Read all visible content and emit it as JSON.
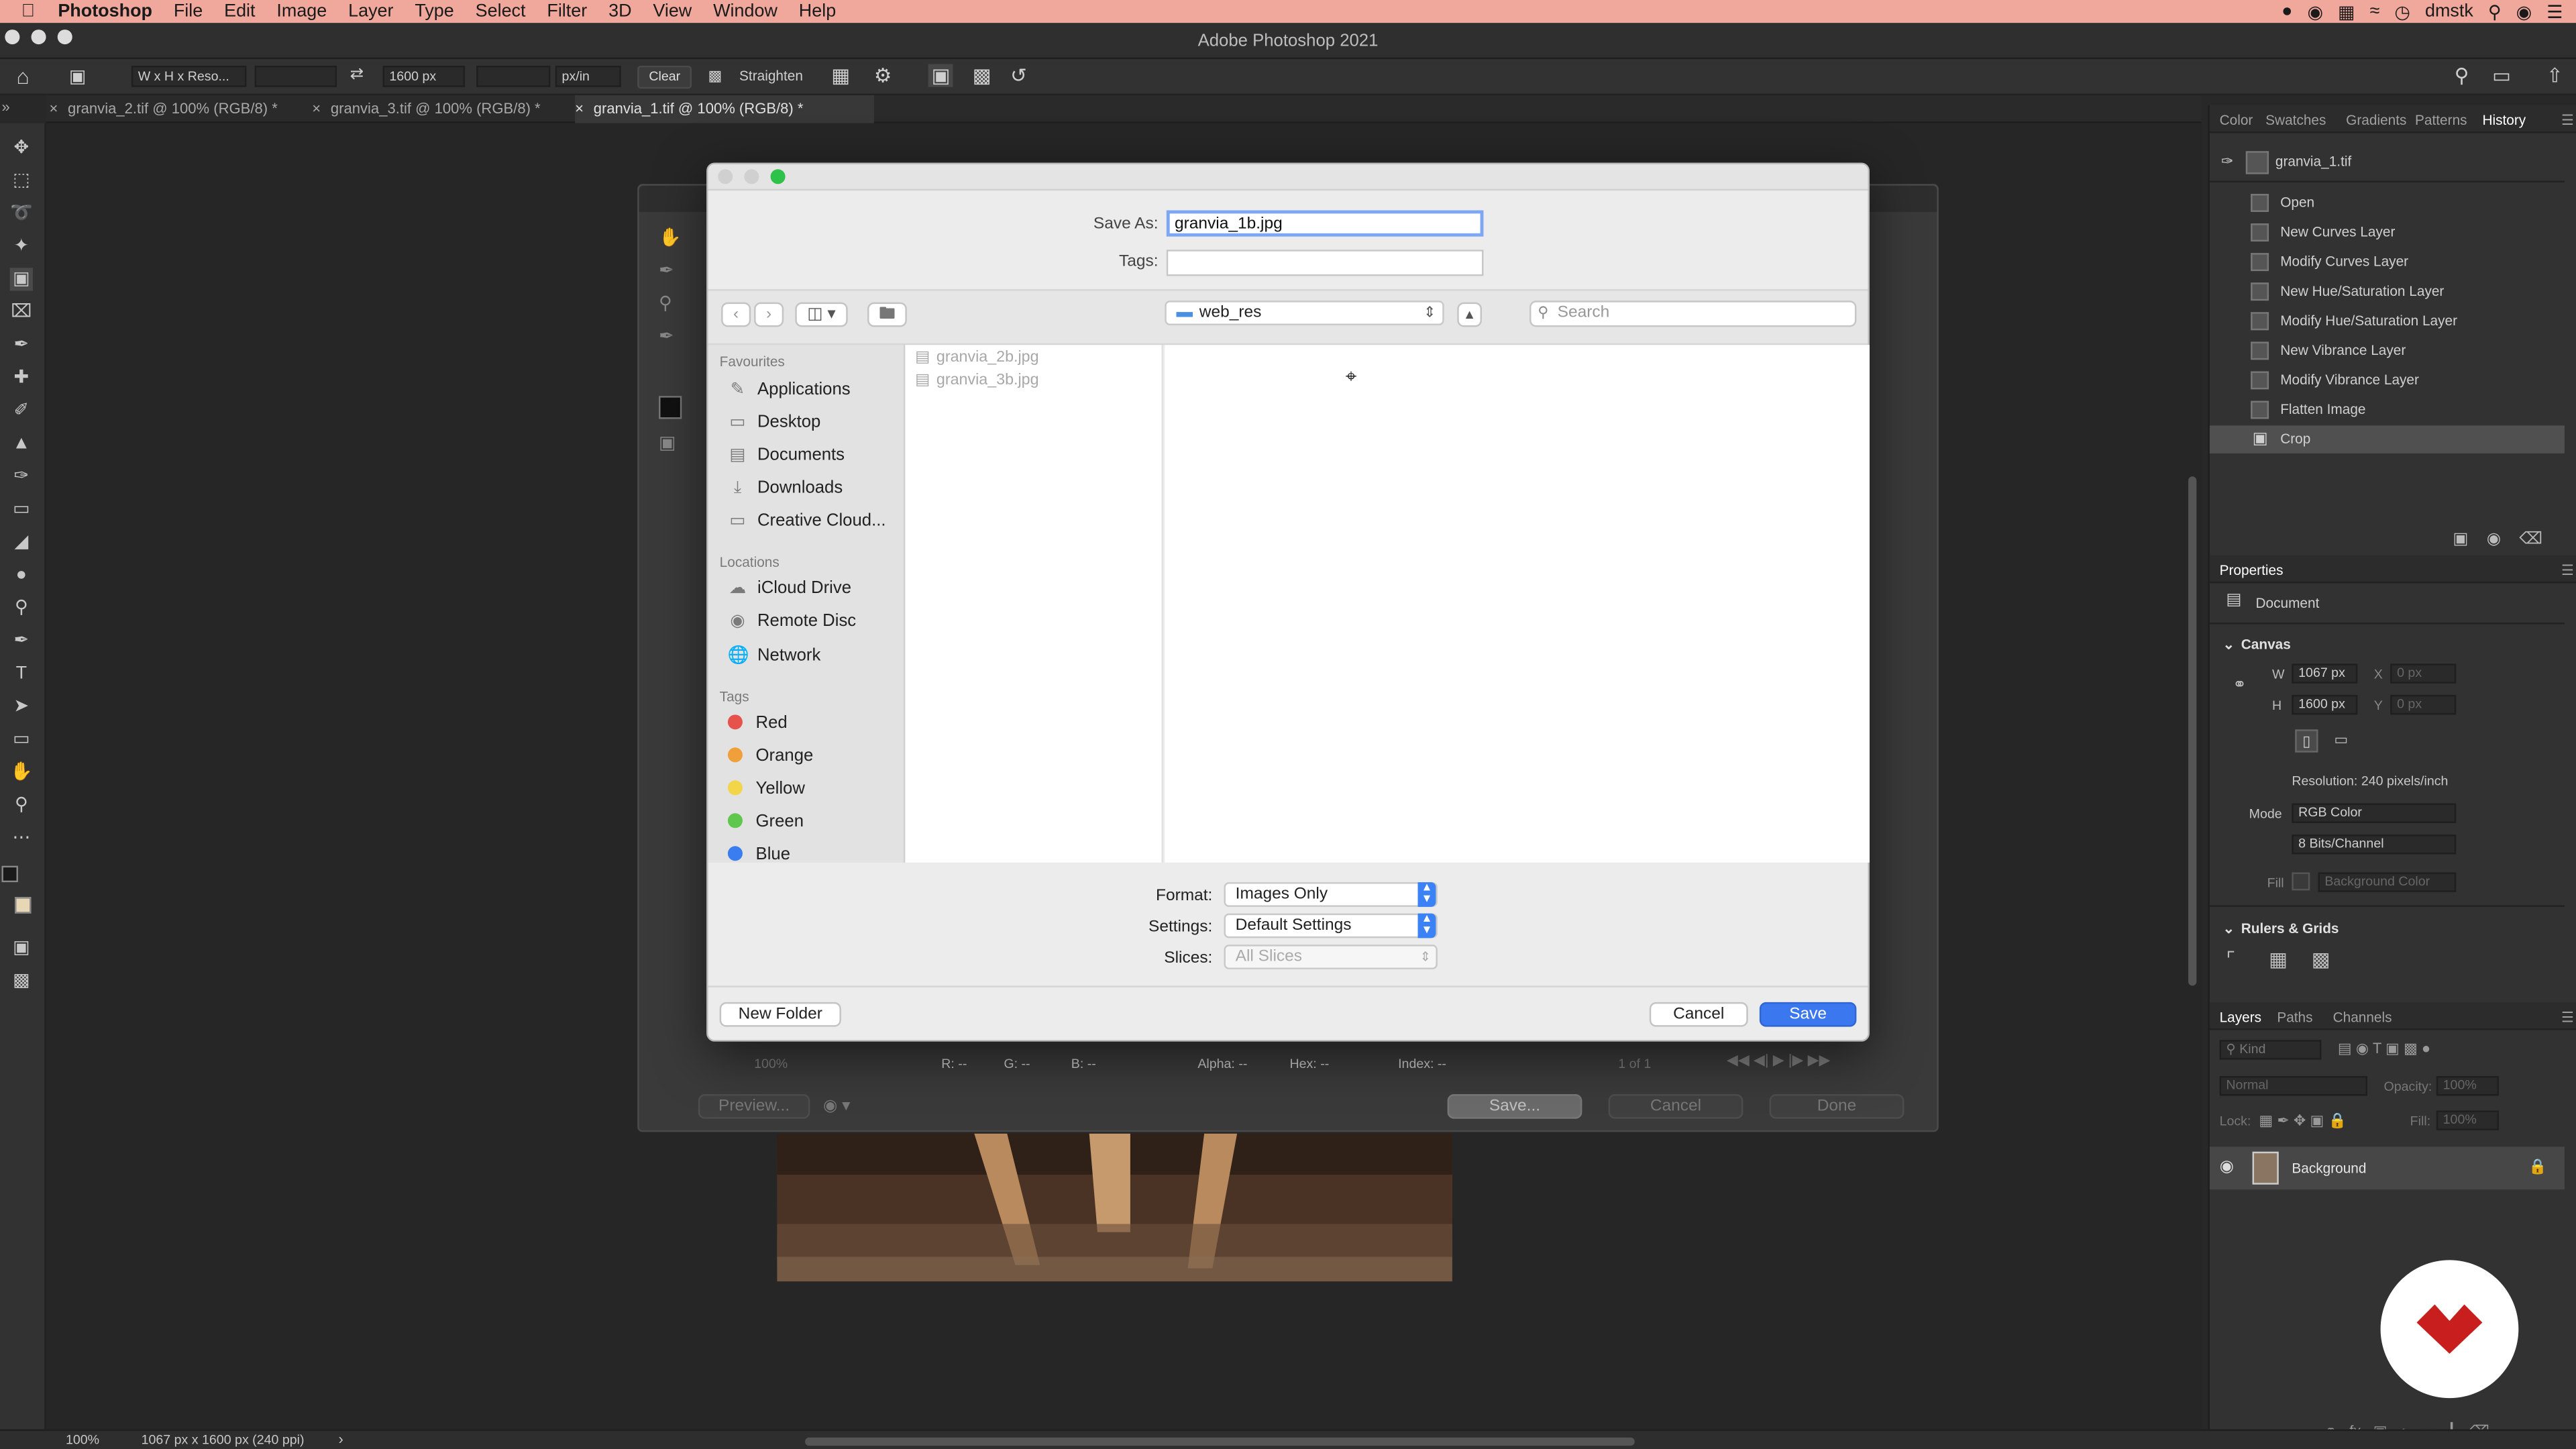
{
  "menubar": {
    "app": "Photoshop",
    "items": [
      "File",
      "Edit",
      "Image",
      "Layer",
      "Type",
      "Select",
      "Filter",
      "3D",
      "View",
      "Window",
      "Help"
    ],
    "user": "dmstk"
  },
  "window": {
    "title": "Adobe Photoshop 2021"
  },
  "options": {
    "ratio": "W x H x Reso...",
    "height": "1600 px",
    "units": "px/in",
    "clear": "Clear",
    "straighten": "Straighten"
  },
  "tabs": [
    {
      "label": "granvia_2.tif @ 100% (RGB/8) *"
    },
    {
      "label": "granvia_3.tif @ 100% (RGB/8) *"
    },
    {
      "label": "granvia_1.tif @ 100% (RGB/8) *"
    }
  ],
  "save_dialog": {
    "save_as_label": "Save As:",
    "save_as_value": "granvia_1b.jpg",
    "tags_label": "Tags:",
    "folder": "web_res",
    "search_placeholder": "Search",
    "favourites_label": "Favourites",
    "favourites": [
      "Applications",
      "Desktop",
      "Documents",
      "Downloads",
      "Creative Cloud..."
    ],
    "locations_label": "Locations",
    "locations": [
      "iCloud Drive",
      "Remote Disc",
      "Network"
    ],
    "tags_section_label": "Tags",
    "tags": [
      {
        "name": "Red",
        "color": "#e5534b"
      },
      {
        "name": "Orange",
        "color": "#f0a03a"
      },
      {
        "name": "Yellow",
        "color": "#f3d54a"
      },
      {
        "name": "Green",
        "color": "#5fc74d"
      },
      {
        "name": "Blue",
        "color": "#3a7df0"
      }
    ],
    "files": [
      "granvia_2b.jpg",
      "granvia_3b.jpg"
    ],
    "format_label": "Format:",
    "format_value": "Images Only",
    "settings_label": "Settings:",
    "settings_value": "Default Settings",
    "slices_label": "Slices:",
    "slices_value": "All Slices",
    "new_folder": "New Folder",
    "cancel": "Cancel",
    "save": "Save"
  },
  "back_dialog": {
    "zoom": "100%",
    "r": "R: --",
    "g": "G: --",
    "b": "B: --",
    "alpha": "Alpha: --",
    "hex": "Hex: --",
    "index": "Index: --",
    "page": "1 of 1",
    "preview": "Preview...",
    "save": "Save...",
    "cancel": "Cancel",
    "done": "Done"
  },
  "history": {
    "tabs": [
      "Color",
      "Swatches",
      "Gradients",
      "Patterns",
      "History"
    ],
    "snapshot": "granvia_1.tif",
    "items": [
      "Open",
      "New Curves Layer",
      "Modify Curves Layer",
      "New Hue/Saturation Layer",
      "Modify Hue/Saturation Layer",
      "New Vibrance Layer",
      "Modify Vibrance Layer",
      "Flatten Image",
      "Crop"
    ]
  },
  "properties": {
    "title": "Properties",
    "doc": "Document",
    "canvas": "Canvas",
    "w_label": "W",
    "w": "1067 px",
    "h_label": "H",
    "h": "1600 px",
    "x_label": "X",
    "y_label": "Y",
    "x_placeholder": "0 px",
    "y_placeholder": "0 px",
    "resolution": "Resolution: 240 pixels/inch",
    "mode_label": "Mode",
    "mode": "RGB Color",
    "depth": "8 Bits/Channel",
    "fill_label": "Fill",
    "fill": "Background Color",
    "rulers": "Rulers & Grids"
  },
  "layers": {
    "tabs": [
      "Layers",
      "Paths",
      "Channels"
    ],
    "kind": "Kind",
    "blend": "Normal",
    "opacity_label": "Opacity:",
    "opacity": "100%",
    "lock_label": "Lock:",
    "fill_label": "Fill:",
    "fill": "100%",
    "layer": "Background"
  },
  "status": {
    "zoom": "100%",
    "info": "1067 px x 1600 px (240 ppi)"
  }
}
